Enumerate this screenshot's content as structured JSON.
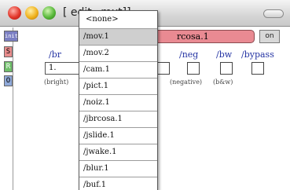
{
  "window": {
    "title": "[          edit_.mxt]]"
  },
  "patch": {
    "init_label": "init",
    "side_labels": [
      "S",
      "R",
      "O"
    ],
    "umenu_value": "rcosa.1",
    "on_label": "on",
    "params": [
      "/br",
      "/neg",
      "/bw",
      "/bypass"
    ],
    "number_value": "1.",
    "captions": [
      "(bright)",
      "(negative)",
      "(b&w)"
    ]
  },
  "menu": {
    "items": [
      "<none>",
      "/mov.1",
      "/mov.2",
      "/cam.1",
      "/pict.1",
      "/noiz.1",
      "/jbrcosa.1",
      "/jslide.1",
      "/jwake.1",
      "/blur.1",
      "/buf.1"
    ],
    "selected": "/mov.1"
  },
  "colors": {
    "umenu": "#e98a92",
    "init": "#7b7fc3",
    "s_box": "#e88c8c",
    "r_box": "#6fbf6a",
    "o_box": "#8fa9d9",
    "param_text": "#2433a3"
  }
}
